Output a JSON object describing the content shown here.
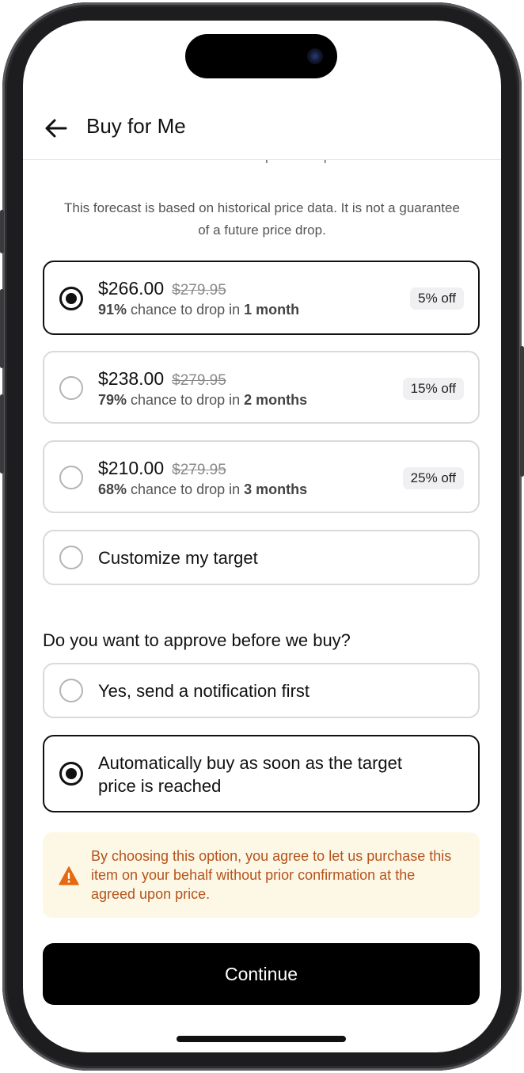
{
  "header": {
    "title": "Buy for Me"
  },
  "section": {
    "partial_heading": "Chance of price drop",
    "disclaimer": "This forecast is based on historical price data. It is not a guarantee of a future price drop."
  },
  "price_options": [
    {
      "price": "$266.00",
      "original": "$279.95",
      "chance": "91%",
      "chance_mid": " chance to drop in ",
      "period": "1 month",
      "discount": "5% off",
      "selected": true
    },
    {
      "price": "$238.00",
      "original": "$279.95",
      "chance": "79%",
      "chance_mid": " chance to drop in ",
      "period": "2 months",
      "discount": "15% off",
      "selected": false
    },
    {
      "price": "$210.00",
      "original": "$279.95",
      "chance": "68%",
      "chance_mid": " chance to drop in ",
      "period": "3 months",
      "discount": "25% off",
      "selected": false
    }
  ],
  "customize": {
    "label": "Customize my target",
    "selected": false
  },
  "approval": {
    "question": "Do you want to approve before we buy?",
    "options": [
      {
        "label": "Yes, send a notification first",
        "selected": false
      },
      {
        "label": "Automatically buy as soon as the target price is reached",
        "selected": true
      }
    ]
  },
  "warning": {
    "icon": "warning-triangle-icon",
    "text": "By choosing this option, you agree to let us purchase this item on your behalf without prior confirmation at the agreed upon price.",
    "color": "#b4521c",
    "background": "#fdf8e6"
  },
  "cta": {
    "label": "Continue"
  }
}
